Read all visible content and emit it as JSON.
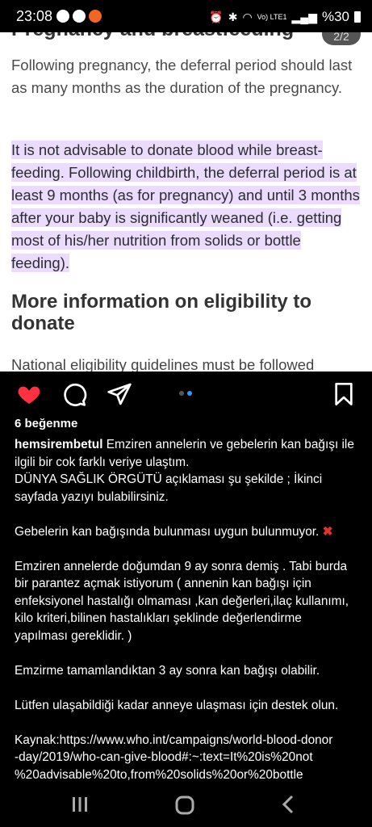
{
  "status_bar": {
    "time": "23:08",
    "network": "Vo) LTE1",
    "battery": "%30"
  },
  "article": {
    "cut_heading": "Pregnancy and breastfeeding",
    "page_indicator": "2/2",
    "para1": "Following pregnancy, the deferral period should last as many months as the duration of the pregnancy.",
    "para2": "It is not advisable to donate blood while breast-feeding. Following childbirth, the deferral period is at least 9 months (as for pregnancy) and until 3 months after your baby is significantly weaned (i.e. getting most of his/her nutrition from solids or bottle feeding).",
    "heading": "More information on eligibility to donate",
    "para3": "National  eligibility guidelines must be followed"
  },
  "post": {
    "likes": "6 beğenme",
    "username": "hemsirembetul",
    "caption_lines": [
      " Emziren annelerin ve gebelerin kan bağışı ile",
      "ilgili bir cok farklı veriye ulaştım.",
      "DÜNYA SAĞLIK ÖRGÜTÜ açıklaması şu şekilde ; İkinci",
      "sayfada yazıyı bulabilirsiniz."
    ],
    "line_pregnant": "Gebelerin kan bağışında bulunması uygun bulunmuyor. ",
    "x_emoji": "✖",
    "para_breastfeeding": [
      "Emziren annelerde doğumdan 9 ay sonra demiş . Tabi burda",
      "bir parantez açmak istiyorum ( annenin kan bağışı için",
      "enfeksiyonel hastalığı olmaması ,kan değerleri,ilaç kullanımı,",
      "kilo kriteri,bilinen hastalıkları şeklinde değerlendirme",
      "yapılması gereklidir. )"
    ],
    "line_weaning": "Emzirme tamamlandıktan 3 ay sonra kan bağışı olabilir.",
    "line_support": "Lütfen ulaşabildiği kadar anneye ulaşması için destek olun.",
    "source_lines": [
      "Kaynak:https://www.who.int/campaigns/world-blood-donor",
      "-day/2019/who-can-give-blood#:~:text=It%20is%20not",
      "%20advisable%20to,from%20solids%20or%20bottle"
    ]
  },
  "icons": {
    "like": "heart-icon",
    "comment": "comment-icon",
    "share": "send-icon",
    "save": "bookmark-icon"
  },
  "colors": {
    "heart": "#ff3040",
    "highlight": "#eadbff",
    "carousel_active": "#3897f0"
  }
}
